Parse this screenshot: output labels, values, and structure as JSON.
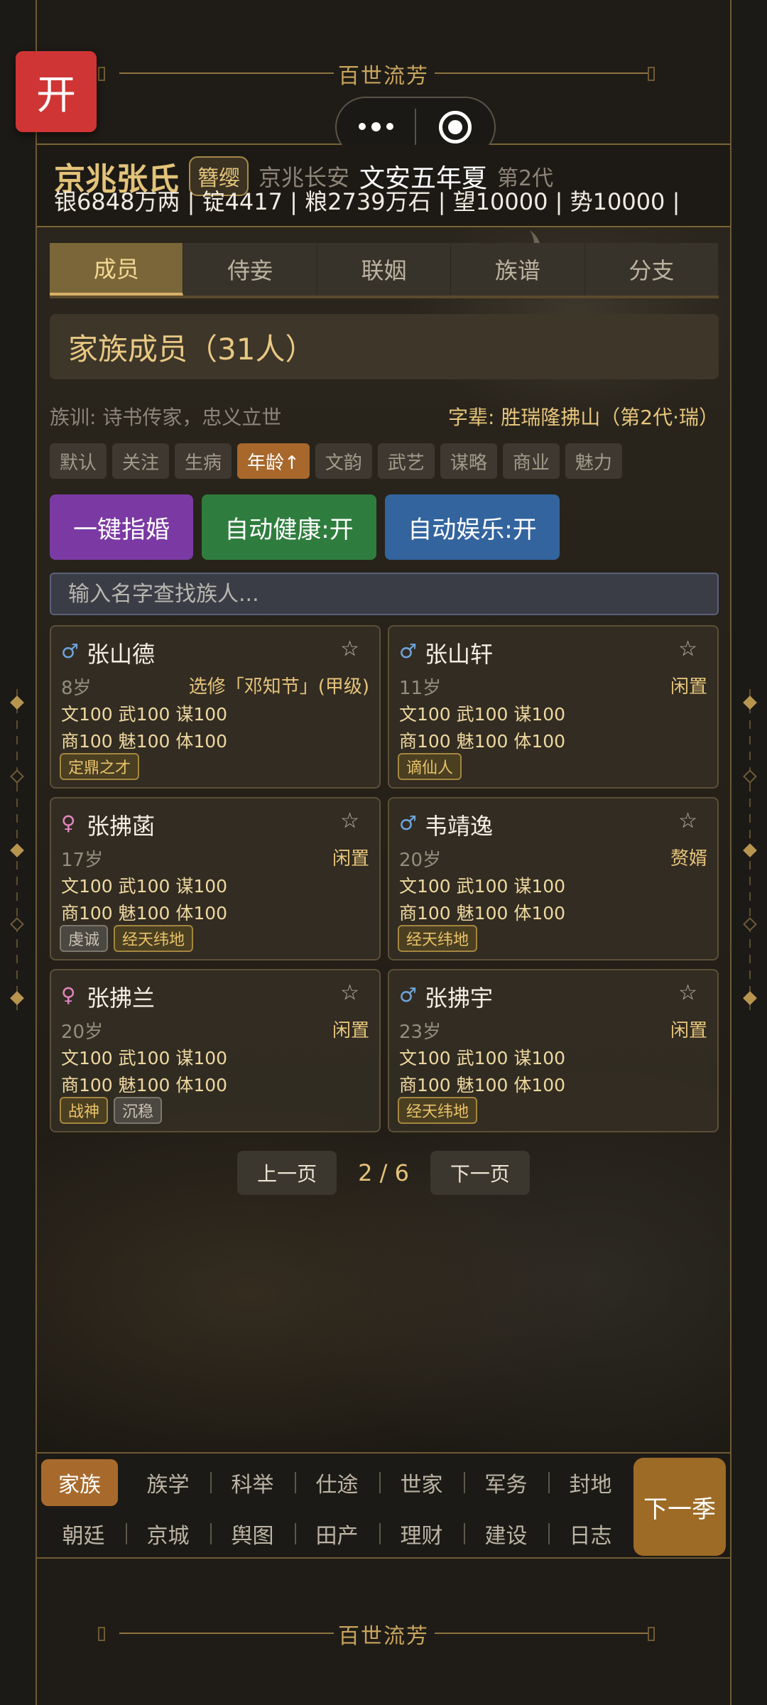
{
  "top": {
    "open_button": "开",
    "deco_title": "百世流芳"
  },
  "clan": {
    "name": "京兆张氏",
    "badge": "簪缨",
    "place": "京兆长安",
    "date": "文安五年夏",
    "generation": "第2代",
    "resources": "银6848万两 | 锭4417 | 粮2739万石 | 望10000 | 势10000 |"
  },
  "tabs": [
    {
      "label": "成员"
    },
    {
      "label": "侍妾"
    },
    {
      "label": "联姻"
    },
    {
      "label": "族谱"
    },
    {
      "label": "分支"
    }
  ],
  "members_title": "家族成员（31人）",
  "motto": "族训: 诗书传家，忠义立世",
  "generation_chars": "字辈: 胜瑞隆拂山（第2代·瑞）",
  "sorts": [
    {
      "label": "默认"
    },
    {
      "label": "关注"
    },
    {
      "label": "生病"
    },
    {
      "label": "年龄↑"
    },
    {
      "label": "文韵"
    },
    {
      "label": "武艺"
    },
    {
      "label": "谋略"
    },
    {
      "label": "商业"
    },
    {
      "label": "魅力"
    }
  ],
  "actions": {
    "matchmake": "一键指婚",
    "auto_health": "自动健康:开",
    "auto_fun": "自动娱乐:开"
  },
  "search": {
    "placeholder": "输入名字查找族人..."
  },
  "members": [
    {
      "gender_symbol": "♂",
      "name": "张山德",
      "age": "8岁",
      "status": "选修「邓知节」(甲级)",
      "stats1": "文100 武100 谋100",
      "stats2": "商100 魅100 体100",
      "tags": [
        "定鼎之才"
      ]
    },
    {
      "gender_symbol": "♂",
      "name": "张山轩",
      "age": "11岁",
      "status": "闲置",
      "stats1": "文100 武100 谋100",
      "stats2": "商100 魅100 体100",
      "tags": [
        "谪仙人"
      ]
    },
    {
      "gender_symbol": "♀",
      "name": "张拂菡",
      "age": "17岁",
      "status": "闲置",
      "stats1": "文100 武100 谋100",
      "stats2": "商100 魅100 体100",
      "tags": [
        "虔诚",
        "经天纬地"
      ]
    },
    {
      "gender_symbol": "♂",
      "name": "韦靖逸",
      "age": "20岁",
      "status": "赘婿",
      "stats1": "文100 武100 谋100",
      "stats2": "商100 魅100 体100",
      "tags": [
        "经天纬地"
      ]
    },
    {
      "gender_symbol": "♀",
      "name": "张拂兰",
      "age": "20岁",
      "status": "闲置",
      "stats1": "文100 武100 谋100",
      "stats2": "商100 魅100 体100",
      "tags": [
        "战神",
        "沉稳"
      ]
    },
    {
      "gender_symbol": "♂",
      "name": "张拂宇",
      "age": "23岁",
      "status": "闲置",
      "stats1": "文100 武100 谋100",
      "stats2": "商100 魅100 体100",
      "tags": [
        "经天纬地"
      ]
    }
  ],
  "pager": {
    "prev": "上一页",
    "indicator": "2 / 6",
    "next": "下一页"
  },
  "nav": {
    "row1": [
      "家族",
      "族学",
      "科举",
      "仕途",
      "世家",
      "军务",
      "封地"
    ],
    "row2": [
      "朝廷",
      "京城",
      "舆图",
      "田产",
      "理财",
      "建设",
      "日志"
    ],
    "next_season": "下一季"
  },
  "colors": {
    "accent_gold": "#e3c37a",
    "active_orange": "#a86a2c",
    "open_red": "#cf3534",
    "purple": "#7b3aa3",
    "green": "#2f7d3e",
    "blue": "#33649e"
  }
}
